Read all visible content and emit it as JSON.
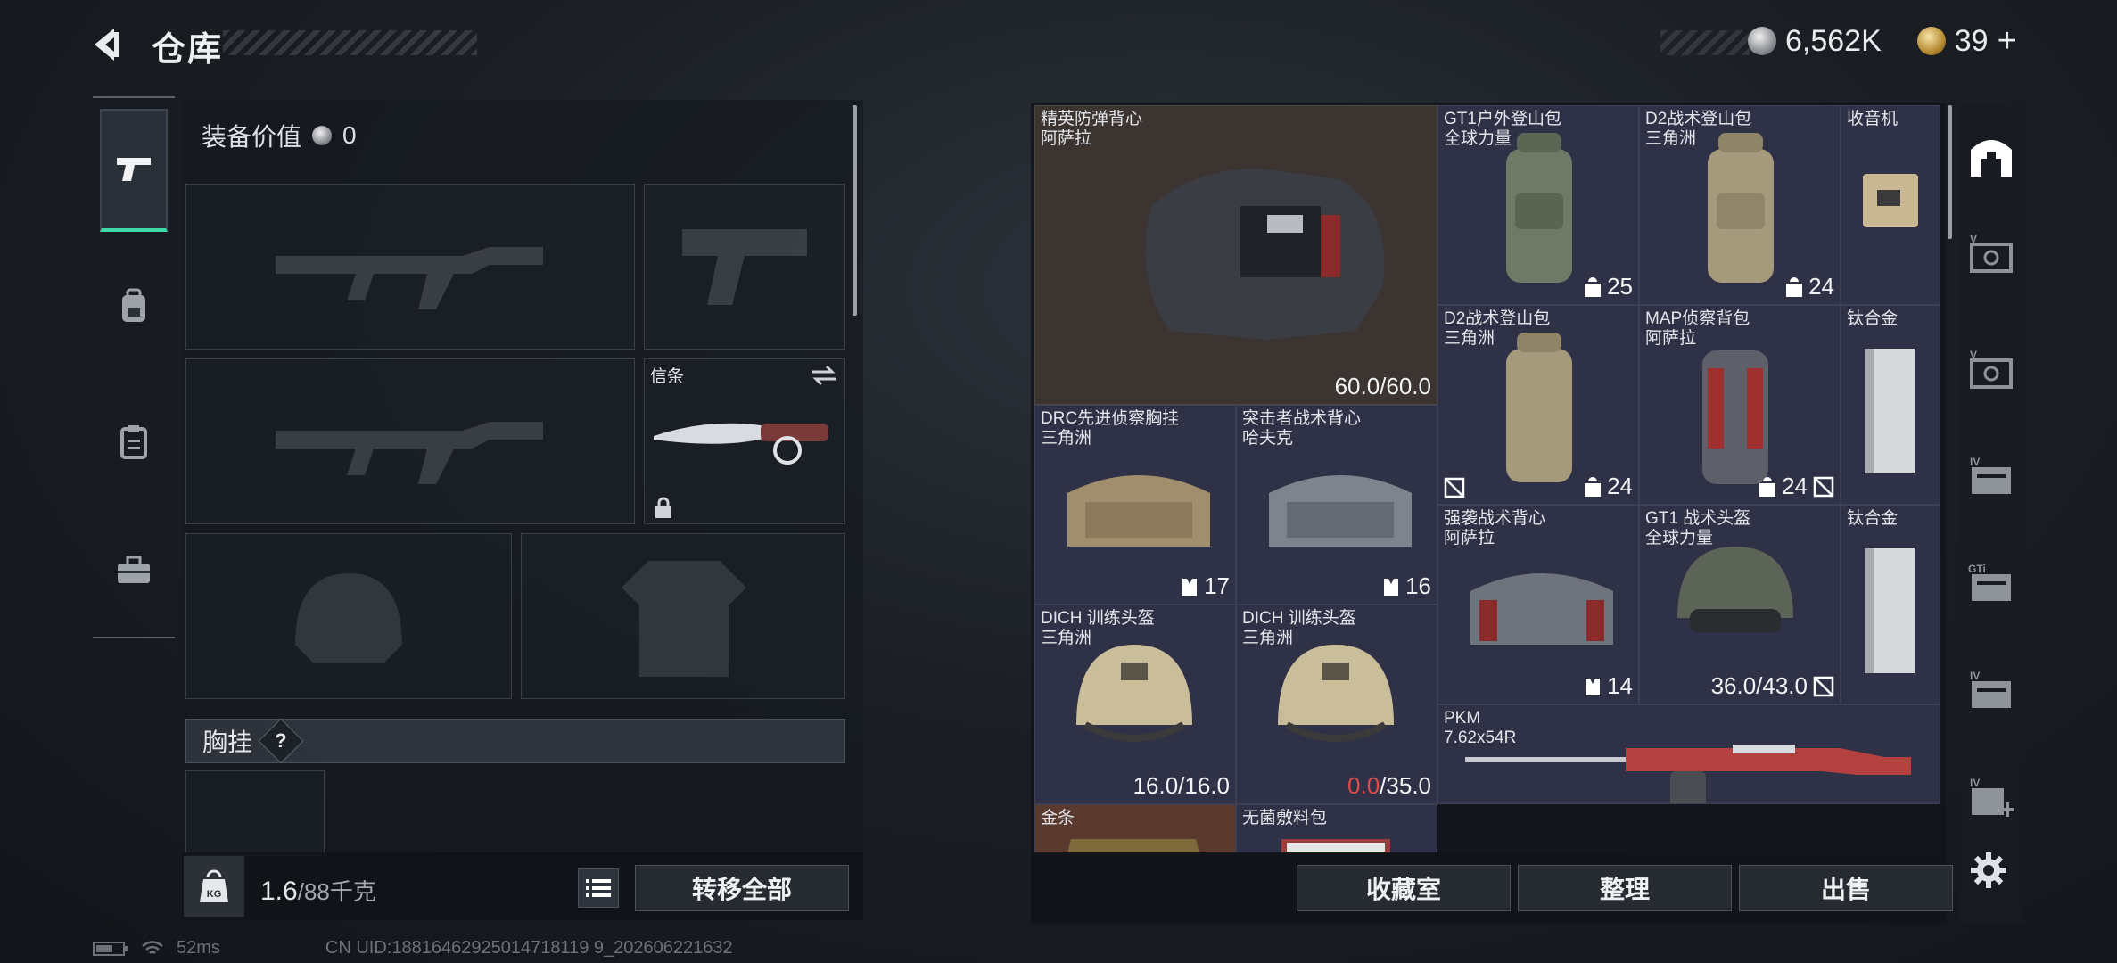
{
  "header": {
    "title": "仓库",
    "currency_silver": "6,562K",
    "currency_gold": "39",
    "add_label": "+"
  },
  "equipment": {
    "value_label": "装备价值",
    "value": "0",
    "melee_label": "信条",
    "chest_rig_label": "胸挂",
    "help_label": "?",
    "weight_current": "1.6",
    "weight_capacity": "/88千克",
    "transfer_all": "转移全部"
  },
  "inventory": {
    "items": [
      {
        "name": "精英防弹背心\n阿萨拉",
        "durability": "60.0/60.0"
      },
      {
        "name": "GT1户外登山包\n全球力量",
        "capacity": "25"
      },
      {
        "name": "D2战术登山包\n三角洲",
        "capacity": "24"
      },
      {
        "name": "收音机"
      },
      {
        "name": "D2战术登山包\n三角洲",
        "capacity": "24"
      },
      {
        "name": "MAP侦察背包\n阿萨拉",
        "capacity": "24"
      },
      {
        "name": "钛合金"
      },
      {
        "name": "DRC先进侦察胸挂\n三角洲",
        "capacity": "17"
      },
      {
        "name": "突击者战术背心\n哈夫克",
        "capacity": "16"
      },
      {
        "name": "强袭战术背心\n阿萨拉",
        "capacity": "14"
      },
      {
        "name": "GT1 战术头盔\n全球力量",
        "durability": "36.0/43.0"
      },
      {
        "name": "钛合金"
      },
      {
        "name": "DICH 训练头盔\n三角洲",
        "durability": "16.0/16.0"
      },
      {
        "name": "DICH 训练头盔\n三角洲",
        "durability_cur": "0.0",
        "durability_max": "/35.0"
      },
      {
        "name": "PKM\n7.62x54R"
      },
      {
        "name": "金条"
      },
      {
        "name": "无菌敷料包"
      }
    ]
  },
  "bottom_buttons": {
    "collection": "收藏室",
    "sort": "整理",
    "sell": "出售"
  },
  "status_bar": {
    "ping": "52ms",
    "uid": "CN UID:18816462925014718119 9_202606221632"
  },
  "colors": {
    "accent": "#3fd8a6",
    "cell_bg": "#2f3146",
    "warning": "#e04a4a"
  }
}
